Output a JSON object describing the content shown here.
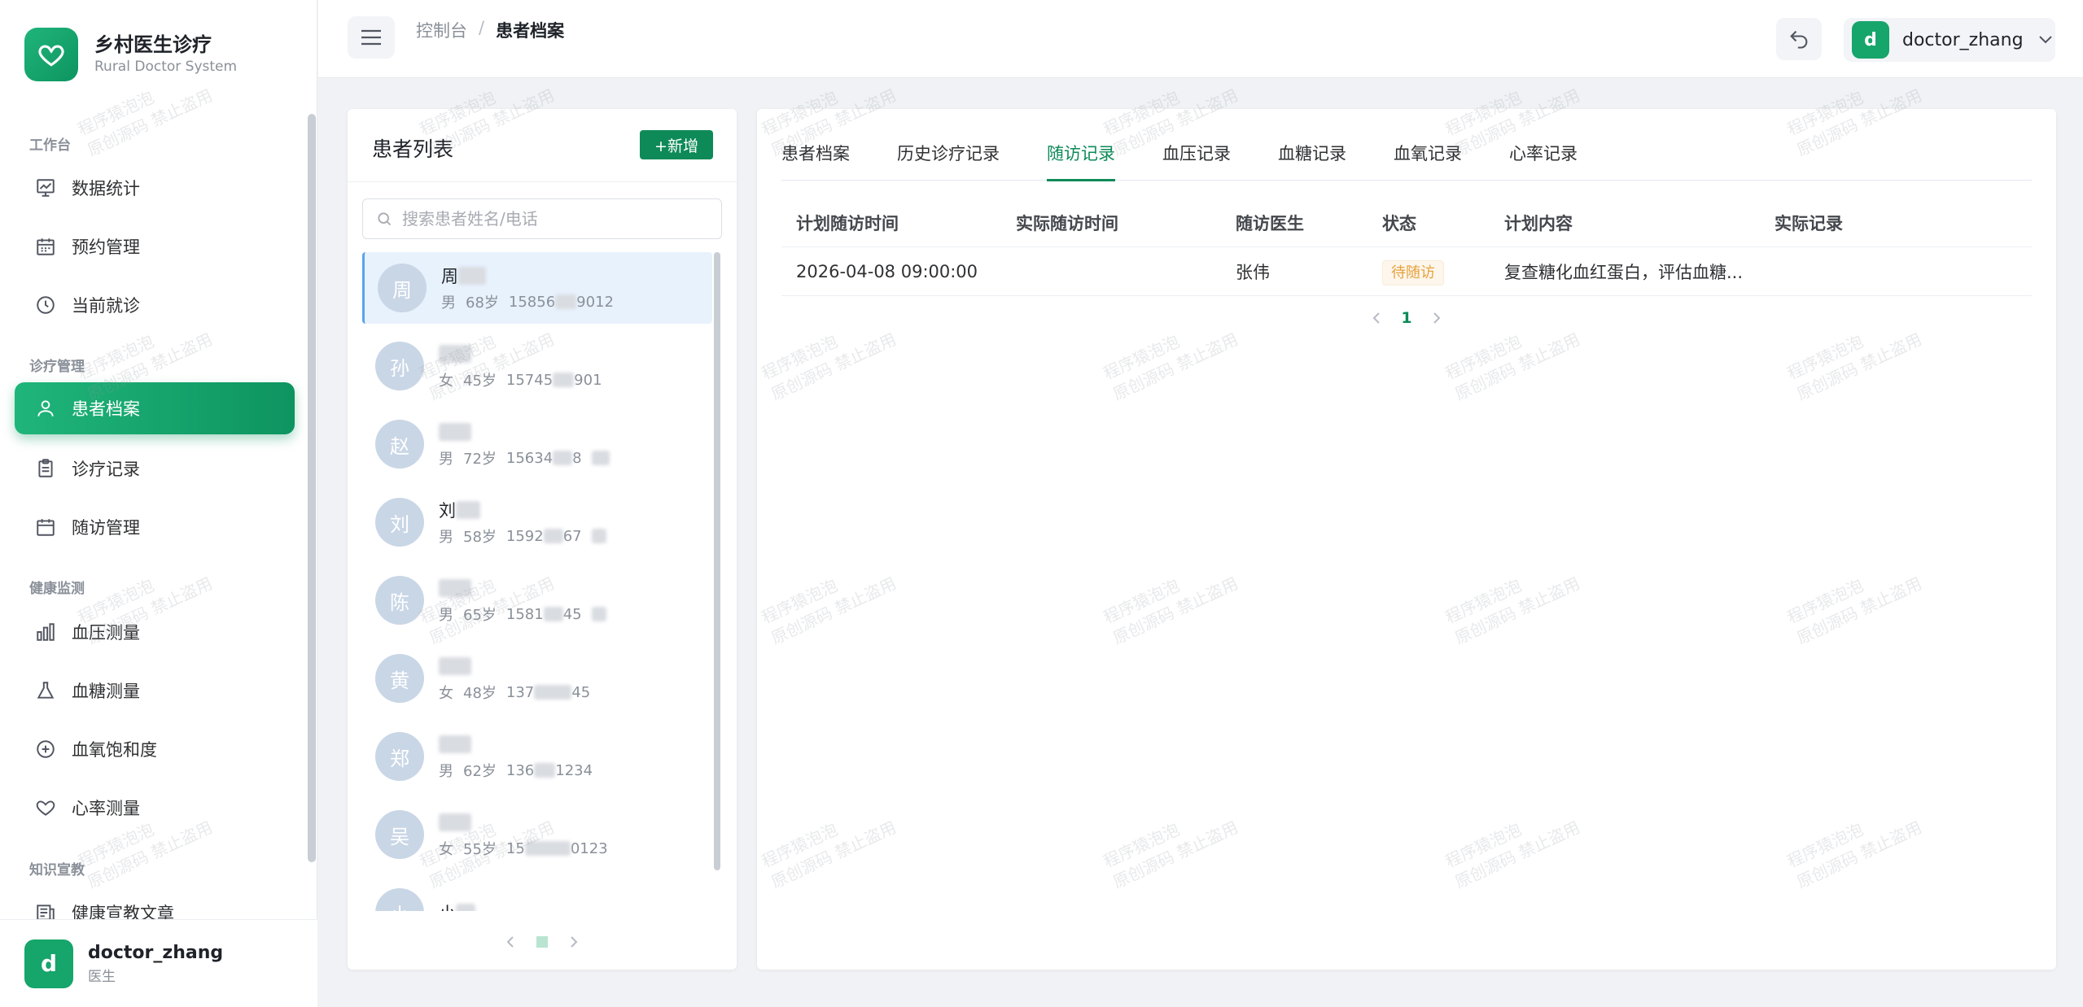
{
  "app": {
    "title": "乡村医生诊疗",
    "subtitle": "Rural Doctor System"
  },
  "sidebar": {
    "groups": [
      {
        "title": "工作台",
        "items": [
          {
            "label": "数据统计"
          },
          {
            "label": "预约管理"
          },
          {
            "label": "当前就诊"
          }
        ]
      },
      {
        "title": "诊疗管理",
        "items": [
          {
            "label": "患者档案"
          },
          {
            "label": "诊疗记录"
          },
          {
            "label": "随访管理"
          }
        ]
      },
      {
        "title": "健康监测",
        "items": [
          {
            "label": "血压测量"
          },
          {
            "label": "血糖测量"
          },
          {
            "label": "血氧饱和度"
          },
          {
            "label": "心率测量"
          }
        ]
      },
      {
        "title": "知识宣教",
        "items": [
          {
            "label": "健康宣教文章"
          }
        ]
      }
    ],
    "active": "患者档案",
    "user": {
      "avatar": "d",
      "name": "doctor_zhang",
      "role": "医生"
    }
  },
  "header": {
    "breadcrumb": [
      "控制台",
      "/",
      "患者档案"
    ],
    "user": {
      "avatar": "d",
      "name": "doctor_zhang"
    }
  },
  "patient_list": {
    "title": "患者列表",
    "add_label": "+新增",
    "search_placeholder": "搜索患者姓名/电话",
    "patients": [
      {
        "initial": "周",
        "name": "周",
        "gender": "男",
        "age": "68岁",
        "phone": "15856",
        "phone_tail": "9012"
      },
      {
        "initial": "孙",
        "name": "",
        "gender": "女",
        "age": "45岁",
        "phone": "15745",
        "phone_tail": "901"
      },
      {
        "initial": "赵",
        "name": "",
        "gender": "男",
        "age": "72岁",
        "phone": "15634",
        "phone_tail": "8"
      },
      {
        "initial": "刘",
        "name": "刘",
        "gender": "男",
        "age": "58岁",
        "phone": "1592",
        "phone_tail": "67"
      },
      {
        "initial": "陈",
        "name": "",
        "gender": "男",
        "age": "65岁",
        "phone": "1581",
        "phone_tail": "45"
      },
      {
        "initial": "黄",
        "name": "",
        "gender": "女",
        "age": "48岁",
        "phone": "137",
        "phone_tail": "45"
      },
      {
        "initial": "郑",
        "name": "",
        "gender": "男",
        "age": "62岁",
        "phone": "136",
        "phone_tail": "1234"
      },
      {
        "initial": "吴",
        "name": "",
        "gender": "女",
        "age": "55岁",
        "phone": "15",
        "phone_tail": "0123"
      },
      {
        "initial": "小",
        "name": "小",
        "gender": "",
        "age": "",
        "phone": "",
        "phone_tail": ""
      }
    ],
    "selected_index": 0
  },
  "detail": {
    "tabs": [
      "患者档案",
      "历史诊疗记录",
      "随访记录",
      "血压记录",
      "血糖记录",
      "血氧记录",
      "心率记录"
    ],
    "active_tab": "随访记录",
    "table": {
      "columns": [
        "计划随访时间",
        "实际随访时间",
        "随访医生",
        "状态",
        "计划内容",
        "实际记录"
      ],
      "rows": [
        {
          "planned": "2026-04-08 09:00:00",
          "actual": "",
          "doctor": "张伟",
          "status": "待随访",
          "plan": "复查糖化血红蛋白，评估血糖...",
          "record": ""
        }
      ]
    },
    "page": "1"
  },
  "watermark": {
    "line1": "程序猿泡泡",
    "line2": "原创源码 禁止盗用"
  },
  "colors": {
    "primary": "#0e8a58",
    "accent_gradient_start": "#1fb57a",
    "warn": "#e6a23c",
    "selected_bg": "#e8f2fd"
  }
}
